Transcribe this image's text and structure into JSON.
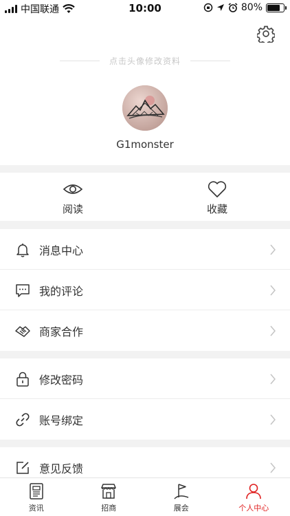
{
  "status_bar": {
    "carrier": "中国联通",
    "time": "10:00",
    "battery": "80%",
    "battery_level": 0.8
  },
  "profile": {
    "hint": "点击头像修改资料",
    "username": "G1monster"
  },
  "quick": {
    "read": "阅读",
    "favorite": "收藏"
  },
  "menu": [
    {
      "label": "消息中心",
      "icon": "bell-icon"
    },
    {
      "label": "我的评论",
      "icon": "comment-icon"
    },
    {
      "label": "商家合作",
      "icon": "handshake-icon"
    },
    {
      "label": "修改密码",
      "icon": "lock-icon"
    },
    {
      "label": "账号绑定",
      "icon": "link-icon"
    },
    {
      "label": "意见反馈",
      "icon": "edit-icon"
    }
  ],
  "tabs": [
    {
      "label": "资讯",
      "icon": "news-icon"
    },
    {
      "label": "招商",
      "icon": "store-icon"
    },
    {
      "label": "展会",
      "icon": "flag-icon"
    },
    {
      "label": "个人中心",
      "icon": "person-icon",
      "active": true
    }
  ],
  "colors": {
    "accent": "#e02020",
    "band": "#f2f2f2"
  }
}
